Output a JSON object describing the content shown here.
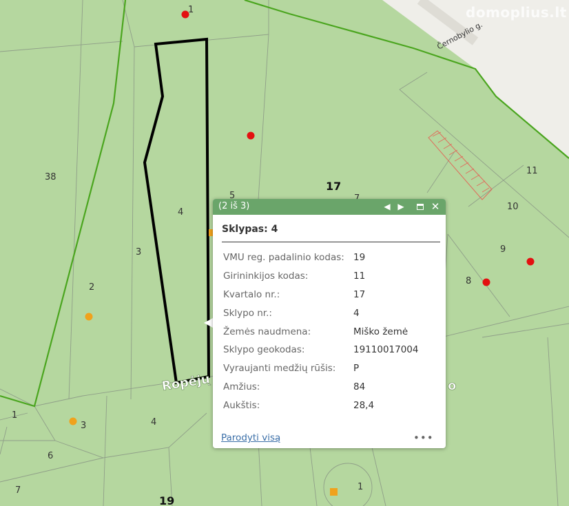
{
  "map": {
    "watermark": "domoplius.lt",
    "street_label": "Černobylio g.",
    "road_label": "Ropėjų",
    "road_label_tail": "o",
    "parcel_labels": [
      "1",
      "38",
      "5",
      "17",
      "7",
      "4",
      "3",
      "2",
      "11",
      "10",
      "9",
      "8",
      "1",
      "3",
      "4",
      "6",
      "7",
      "19",
      "1"
    ],
    "colors": {
      "forest": "#b5d79f",
      "urban": "#efeee9",
      "boundary_green": "#4aa51e",
      "selection": "#000000",
      "point_red": "#e31010",
      "point_orange": "#f0a21c"
    }
  },
  "popup": {
    "counter": "(2 iš 3)",
    "title": "Sklypas: 4",
    "attributes": [
      {
        "key": "VMU reg. padalinio kodas:",
        "value": "19"
      },
      {
        "key": "Girininkijos kodas:",
        "value": "11"
      },
      {
        "key": "Kvartalo nr.:",
        "value": "17"
      },
      {
        "key": "Sklypo nr.:",
        "value": "4"
      },
      {
        "key": "Žemės naudmena:",
        "value": "Miško žemė"
      },
      {
        "key": "Sklypo geokodas:",
        "value": "19110017004"
      },
      {
        "key": "Vyraujanti medžių rūšis:",
        "value": "P"
      },
      {
        "key": "Amžius:",
        "value": "84"
      },
      {
        "key": "Aukštis:",
        "value": "28,4"
      }
    ],
    "zoom_link": "Parodyti visą",
    "more": "•••"
  }
}
